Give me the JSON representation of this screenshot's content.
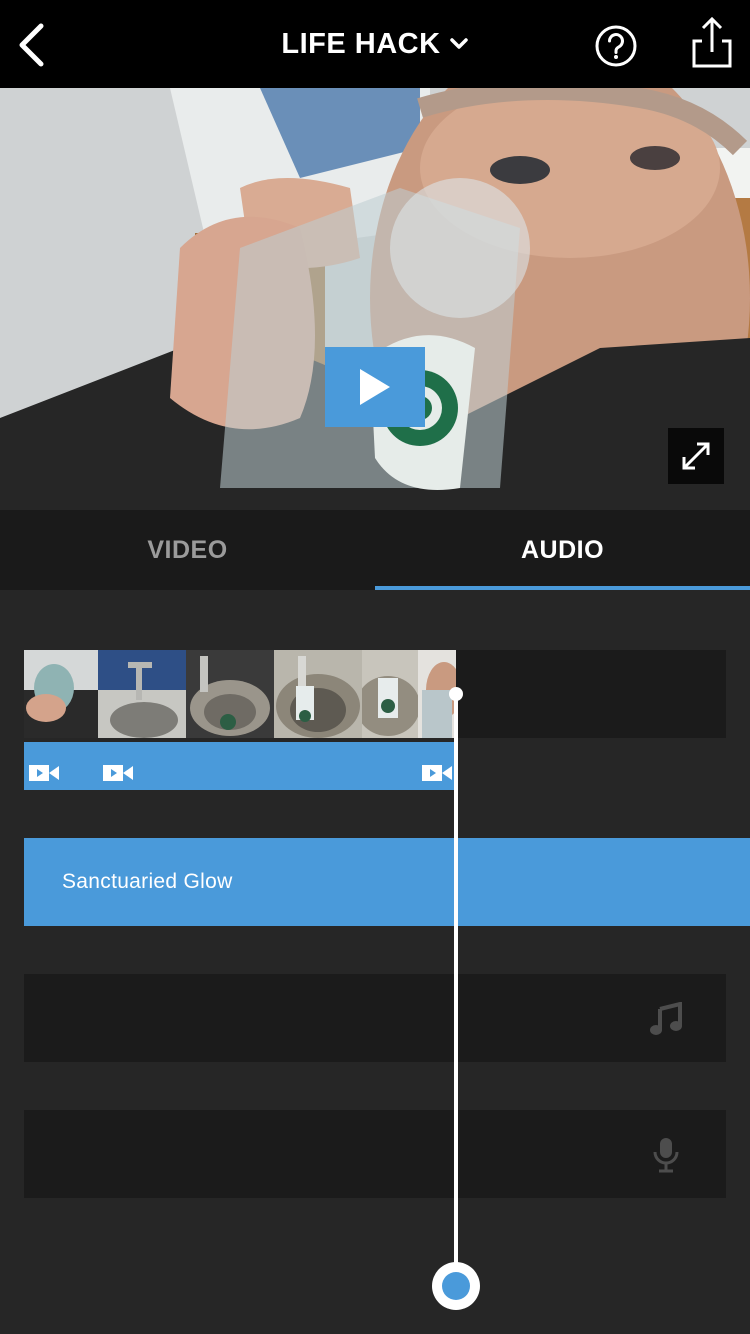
{
  "header": {
    "title": "LIFE HACK",
    "back_icon": "chevron-left-icon",
    "title_dropdown_icon": "chevron-down-icon",
    "help_icon": "help-circle-icon",
    "share_icon": "share-icon"
  },
  "preview": {
    "play_icon": "play-icon",
    "fullscreen_icon": "expand-icon"
  },
  "tabs": [
    {
      "label": "VIDEO",
      "active": false
    },
    {
      "label": "AUDIO",
      "active": true
    }
  ],
  "timeline": {
    "video_clips_count": 6,
    "clip_icon": "video-camera-icon",
    "music_track": {
      "label": "Sanctuaried Glow"
    },
    "music_icon": "music-note-icon",
    "voiceover_icon": "microphone-icon"
  },
  "colors": {
    "accent": "#4a9ada",
    "background": "#262626",
    "track": "#1b1b1b",
    "topbar": "#000000"
  }
}
